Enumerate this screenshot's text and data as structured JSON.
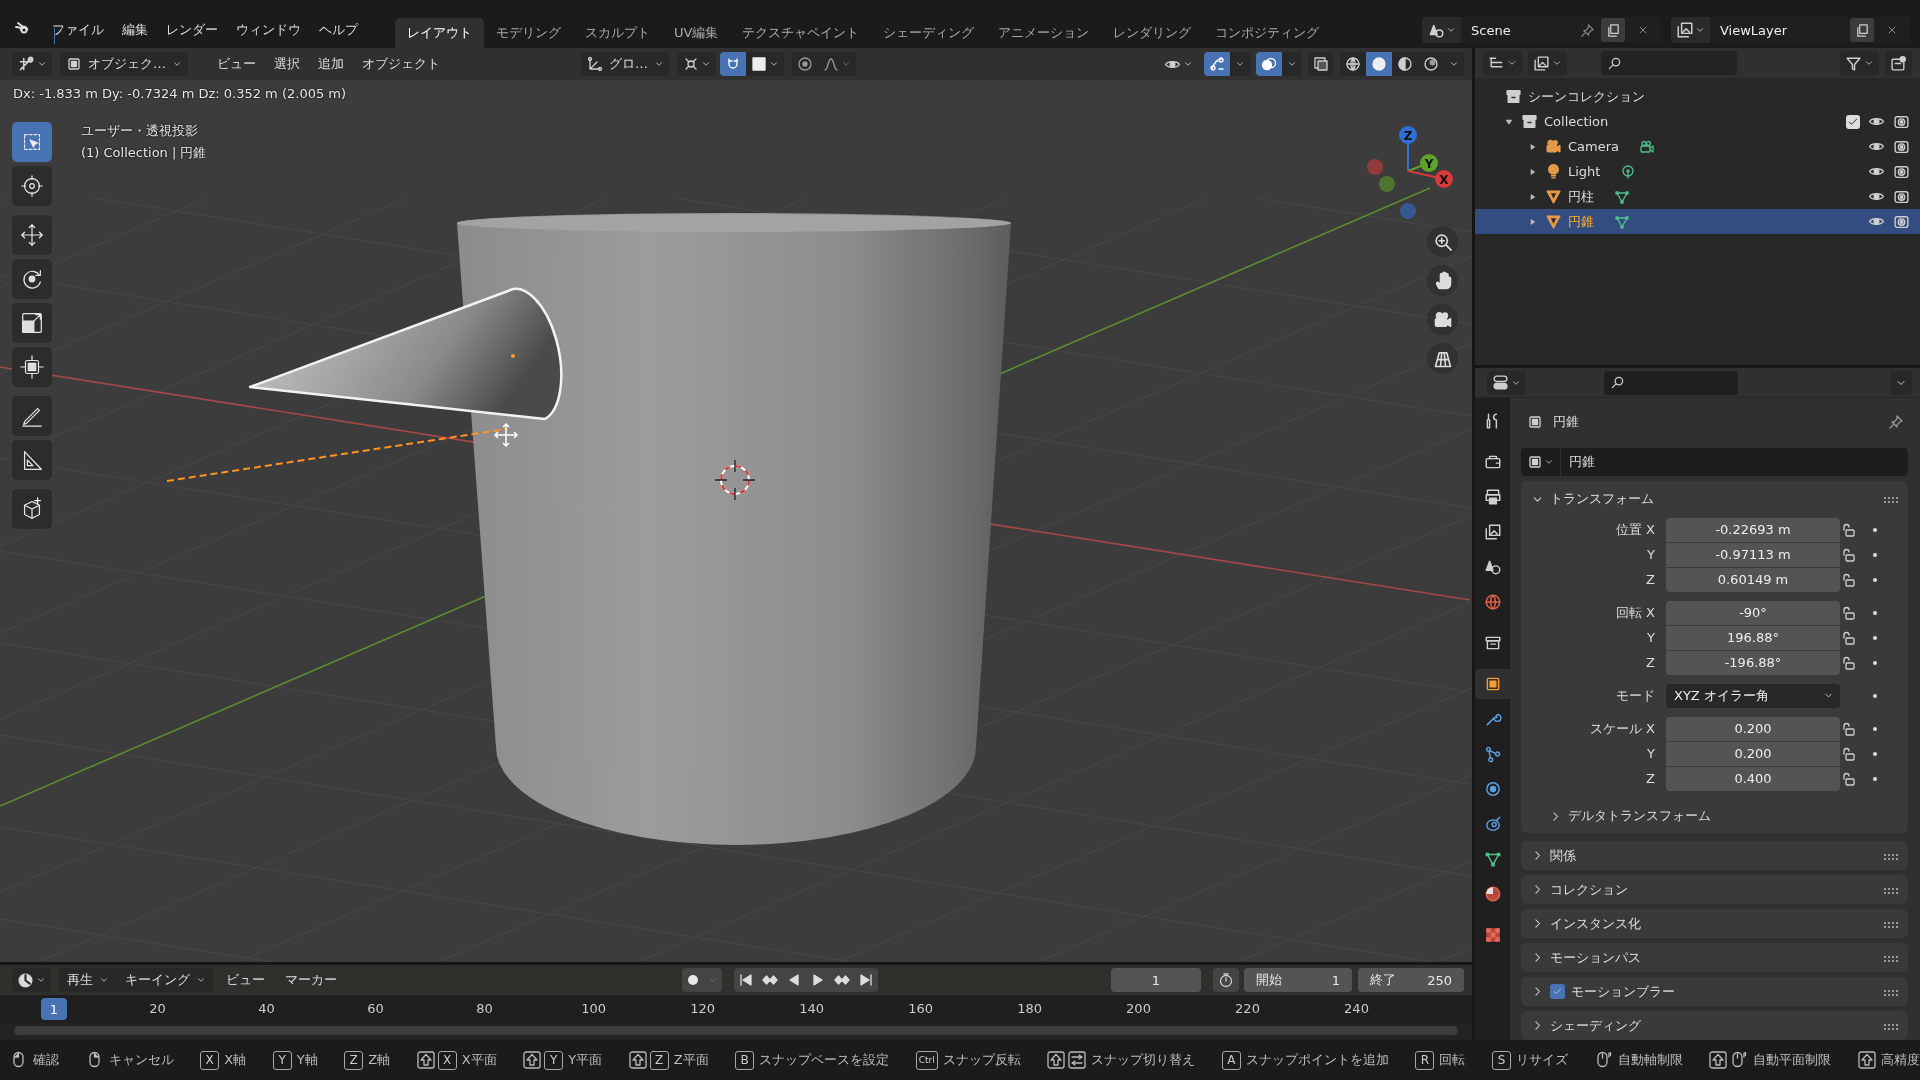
{
  "top_bar": {
    "menus": [
      "ファイル",
      "編集",
      "レンダー",
      "ウィンドウ",
      "ヘルプ"
    ],
    "workspaces": [
      {
        "label": "レイアウト",
        "selected": true
      },
      {
        "label": "モデリング",
        "selected": false
      },
      {
        "label": "スカルプト",
        "selected": false
      },
      {
        "label": "UV編集",
        "selected": false
      },
      {
        "label": "テクスチャペイント",
        "selected": false
      },
      {
        "label": "シェーディング",
        "selected": false
      },
      {
        "label": "アニメーション",
        "selected": false
      },
      {
        "label": "レンダリング",
        "selected": false
      },
      {
        "label": "コンポジティング",
        "selected": false
      }
    ],
    "scene": "Scene",
    "view_layer": "ViewLayer"
  },
  "viewport_header": {
    "mode": "オブジェク…",
    "menus": [
      "ビュー",
      "選択",
      "追加",
      "オブジェクト"
    ],
    "orientation": "グロ…",
    "snap_on": true,
    "proportional_on": false,
    "gizmos_on": true,
    "overlays_on": true,
    "xray_on": false,
    "shading_modes": [
      {
        "kind": "wireframe",
        "selected": false
      },
      {
        "kind": "solid",
        "selected": true
      },
      {
        "kind": "material",
        "selected": false
      },
      {
        "kind": "rendered",
        "selected": false
      }
    ]
  },
  "viewport": {
    "transform_info": "Dx: -1.833 m   Dy: -0.7324 m   Dz: 0.352 m (2.005 m)",
    "view_name": "ユーザー・透視投影",
    "object_info": "(1) Collection | 円錐",
    "tools": [
      {
        "kind": "select_box",
        "selected": true
      },
      {
        "kind": "cursor",
        "selected": false
      },
      {
        "kind": "move",
        "selected": false
      },
      {
        "kind": "rotate",
        "selected": false
      },
      {
        "kind": "scale",
        "selected": false
      },
      {
        "kind": "transform",
        "selected": false
      },
      {
        "kind": "annotate",
        "selected": false
      },
      {
        "kind": "measure",
        "selected": false
      },
      {
        "kind": "add_cube",
        "selected": false
      }
    ],
    "gizmo_axes": [
      {
        "kind": "z",
        "label": "Z"
      },
      {
        "kind": "y",
        "label": "Y"
      },
      {
        "kind": "x",
        "label": "X"
      }
    ]
  },
  "outliner": {
    "root": "シーンコレクション",
    "items": [
      {
        "label": "Collection",
        "kind": "collection",
        "expanded": true,
        "checked": true,
        "selected": false,
        "children": [
          {
            "label": "Camera",
            "kind": "camera",
            "expanded": false,
            "selected": false
          },
          {
            "label": "Light",
            "kind": "light",
            "expanded": false,
            "selected": false
          },
          {
            "label": "円柱",
            "kind": "mesh",
            "expanded": false,
            "selected": false
          },
          {
            "label": "円錐",
            "kind": "mesh",
            "expanded": false,
            "selected": true
          }
        ]
      }
    ]
  },
  "properties": {
    "tabs": [
      {
        "kind": "tool",
        "selected": false
      },
      {
        "kind": "render",
        "selected": false
      },
      {
        "kind": "output",
        "selected": false
      },
      {
        "kind": "view_layer",
        "selected": false
      },
      {
        "kind": "scene",
        "selected": false
      },
      {
        "kind": "world",
        "selected": false
      },
      {
        "kind": "collection",
        "selected": false
      },
      {
        "kind": "object",
        "selected": true
      },
      {
        "kind": "modifiers",
        "selected": false
      },
      {
        "kind": "particles",
        "selected": false
      },
      {
        "kind": "physics",
        "selected": false
      },
      {
        "kind": "constraints",
        "selected": false
      },
      {
        "kind": "data",
        "selected": false
      },
      {
        "kind": "material",
        "selected": false
      },
      {
        "kind": "texture",
        "selected": false
      }
    ],
    "context": "円錐",
    "object_name": "円錐",
    "transform": {
      "title": "トランスフォーム",
      "expanded": true,
      "groups": [
        [
          {
            "kind": "number",
            "label": "位置 X",
            "value": "-0.22693 m"
          },
          {
            "kind": "number",
            "label": "Y",
            "value": "-0.97113 m"
          },
          {
            "kind": "number",
            "label": "Z",
            "value": "0.60149 m"
          }
        ],
        [
          {
            "kind": "number",
            "label": "回転 X",
            "value": "-90°"
          },
          {
            "kind": "number",
            "label": "Y",
            "value": "196.88°"
          },
          {
            "kind": "number",
            "label": "Z",
            "value": "-196.88°"
          }
        ],
        [
          {
            "kind": "dropdown",
            "label": "モード",
            "value": "XYZ オイラー角"
          }
        ],
        [
          {
            "kind": "number",
            "label": "スケール X",
            "value": "0.200"
          },
          {
            "kind": "number",
            "label": "Y",
            "value": "0.200"
          },
          {
            "kind": "number",
            "label": "Z",
            "value": "0.400"
          }
        ]
      ],
      "subpanel": {
        "title": "デルタトランスフォーム",
        "expanded": false
      }
    },
    "panels": [
      {
        "title": "関係",
        "expanded": false
      },
      {
        "title": "コレクション",
        "expanded": false
      },
      {
        "title": "インスタンス化",
        "expanded": false
      },
      {
        "title": "モーションパス",
        "expanded": false
      },
      {
        "title": "モーションブラー",
        "expanded": false,
        "checked": true
      },
      {
        "title": "シェーディング",
        "expanded": false
      }
    ]
  },
  "timeline": {
    "menus": [
      {
        "label": "再生",
        "dropdown": true
      },
      {
        "label": "キーイング",
        "dropdown": true
      },
      {
        "label": "ビュー",
        "dropdown": false
      },
      {
        "label": "マーカー",
        "dropdown": false
      }
    ],
    "auto_key": false,
    "current_frame": "1",
    "start_label": "開始",
    "start": "1",
    "end_label": "終了",
    "end": "250",
    "playhead": "1",
    "ruler": [
      "20",
      "40",
      "60",
      "80",
      "100",
      "120",
      "140",
      "160",
      "180",
      "200",
      "220",
      "240"
    ]
  },
  "status_bar": {
    "hints": [
      {
        "keys": [
          {
            "kind": "mouse_left"
          }
        ],
        "label": "確認"
      },
      {
        "keys": [
          {
            "kind": "mouse_right"
          }
        ],
        "label": "キャンセル"
      },
      {
        "keys": [
          {
            "kind": "key",
            "text": "X"
          }
        ],
        "label": "X軸"
      },
      {
        "keys": [
          {
            "kind": "key",
            "text": "Y"
          }
        ],
        "label": "Y軸"
      },
      {
        "keys": [
          {
            "kind": "key",
            "text": "Z"
          }
        ],
        "label": "Z軸"
      },
      {
        "keys": [
          {
            "kind": "shift"
          },
          {
            "kind": "key",
            "text": "X"
          }
        ],
        "label": "X平面"
      },
      {
        "keys": [
          {
            "kind": "shift"
          },
          {
            "kind": "key",
            "text": "Y"
          }
        ],
        "label": "Y平面"
      },
      {
        "keys": [
          {
            "kind": "shift"
          },
          {
            "kind": "key",
            "text": "Z"
          }
        ],
        "label": "Z平面"
      },
      {
        "keys": [
          {
            "kind": "key",
            "text": "B"
          }
        ],
        "label": "スナップベースを設定"
      },
      {
        "keys": [
          {
            "kind": "key",
            "text": "Ctrl"
          }
        ],
        "label": "スナップ反転"
      },
      {
        "keys": [
          {
            "kind": "shift"
          },
          {
            "kind": "tab"
          }
        ],
        "label": "スナップ切り替え"
      },
      {
        "keys": [
          {
            "kind": "key",
            "text": "A"
          }
        ],
        "label": "スナップポイントを追加"
      },
      {
        "keys": [
          {
            "kind": "key",
            "text": "R"
          }
        ],
        "label": "回転"
      },
      {
        "keys": [
          {
            "kind": "key",
            "text": "S"
          }
        ],
        "label": "リサイズ"
      },
      {
        "keys": [
          {
            "kind": "mouse_middle"
          }
        ],
        "label": "自動軸制限"
      },
      {
        "keys": [
          {
            "kind": "shift"
          },
          {
            "kind": "mouse_middle"
          }
        ],
        "label": "自動平面制限"
      },
      {
        "keys": [
          {
            "kind": "shift"
          }
        ],
        "label": "高精度"
      }
    ]
  }
}
